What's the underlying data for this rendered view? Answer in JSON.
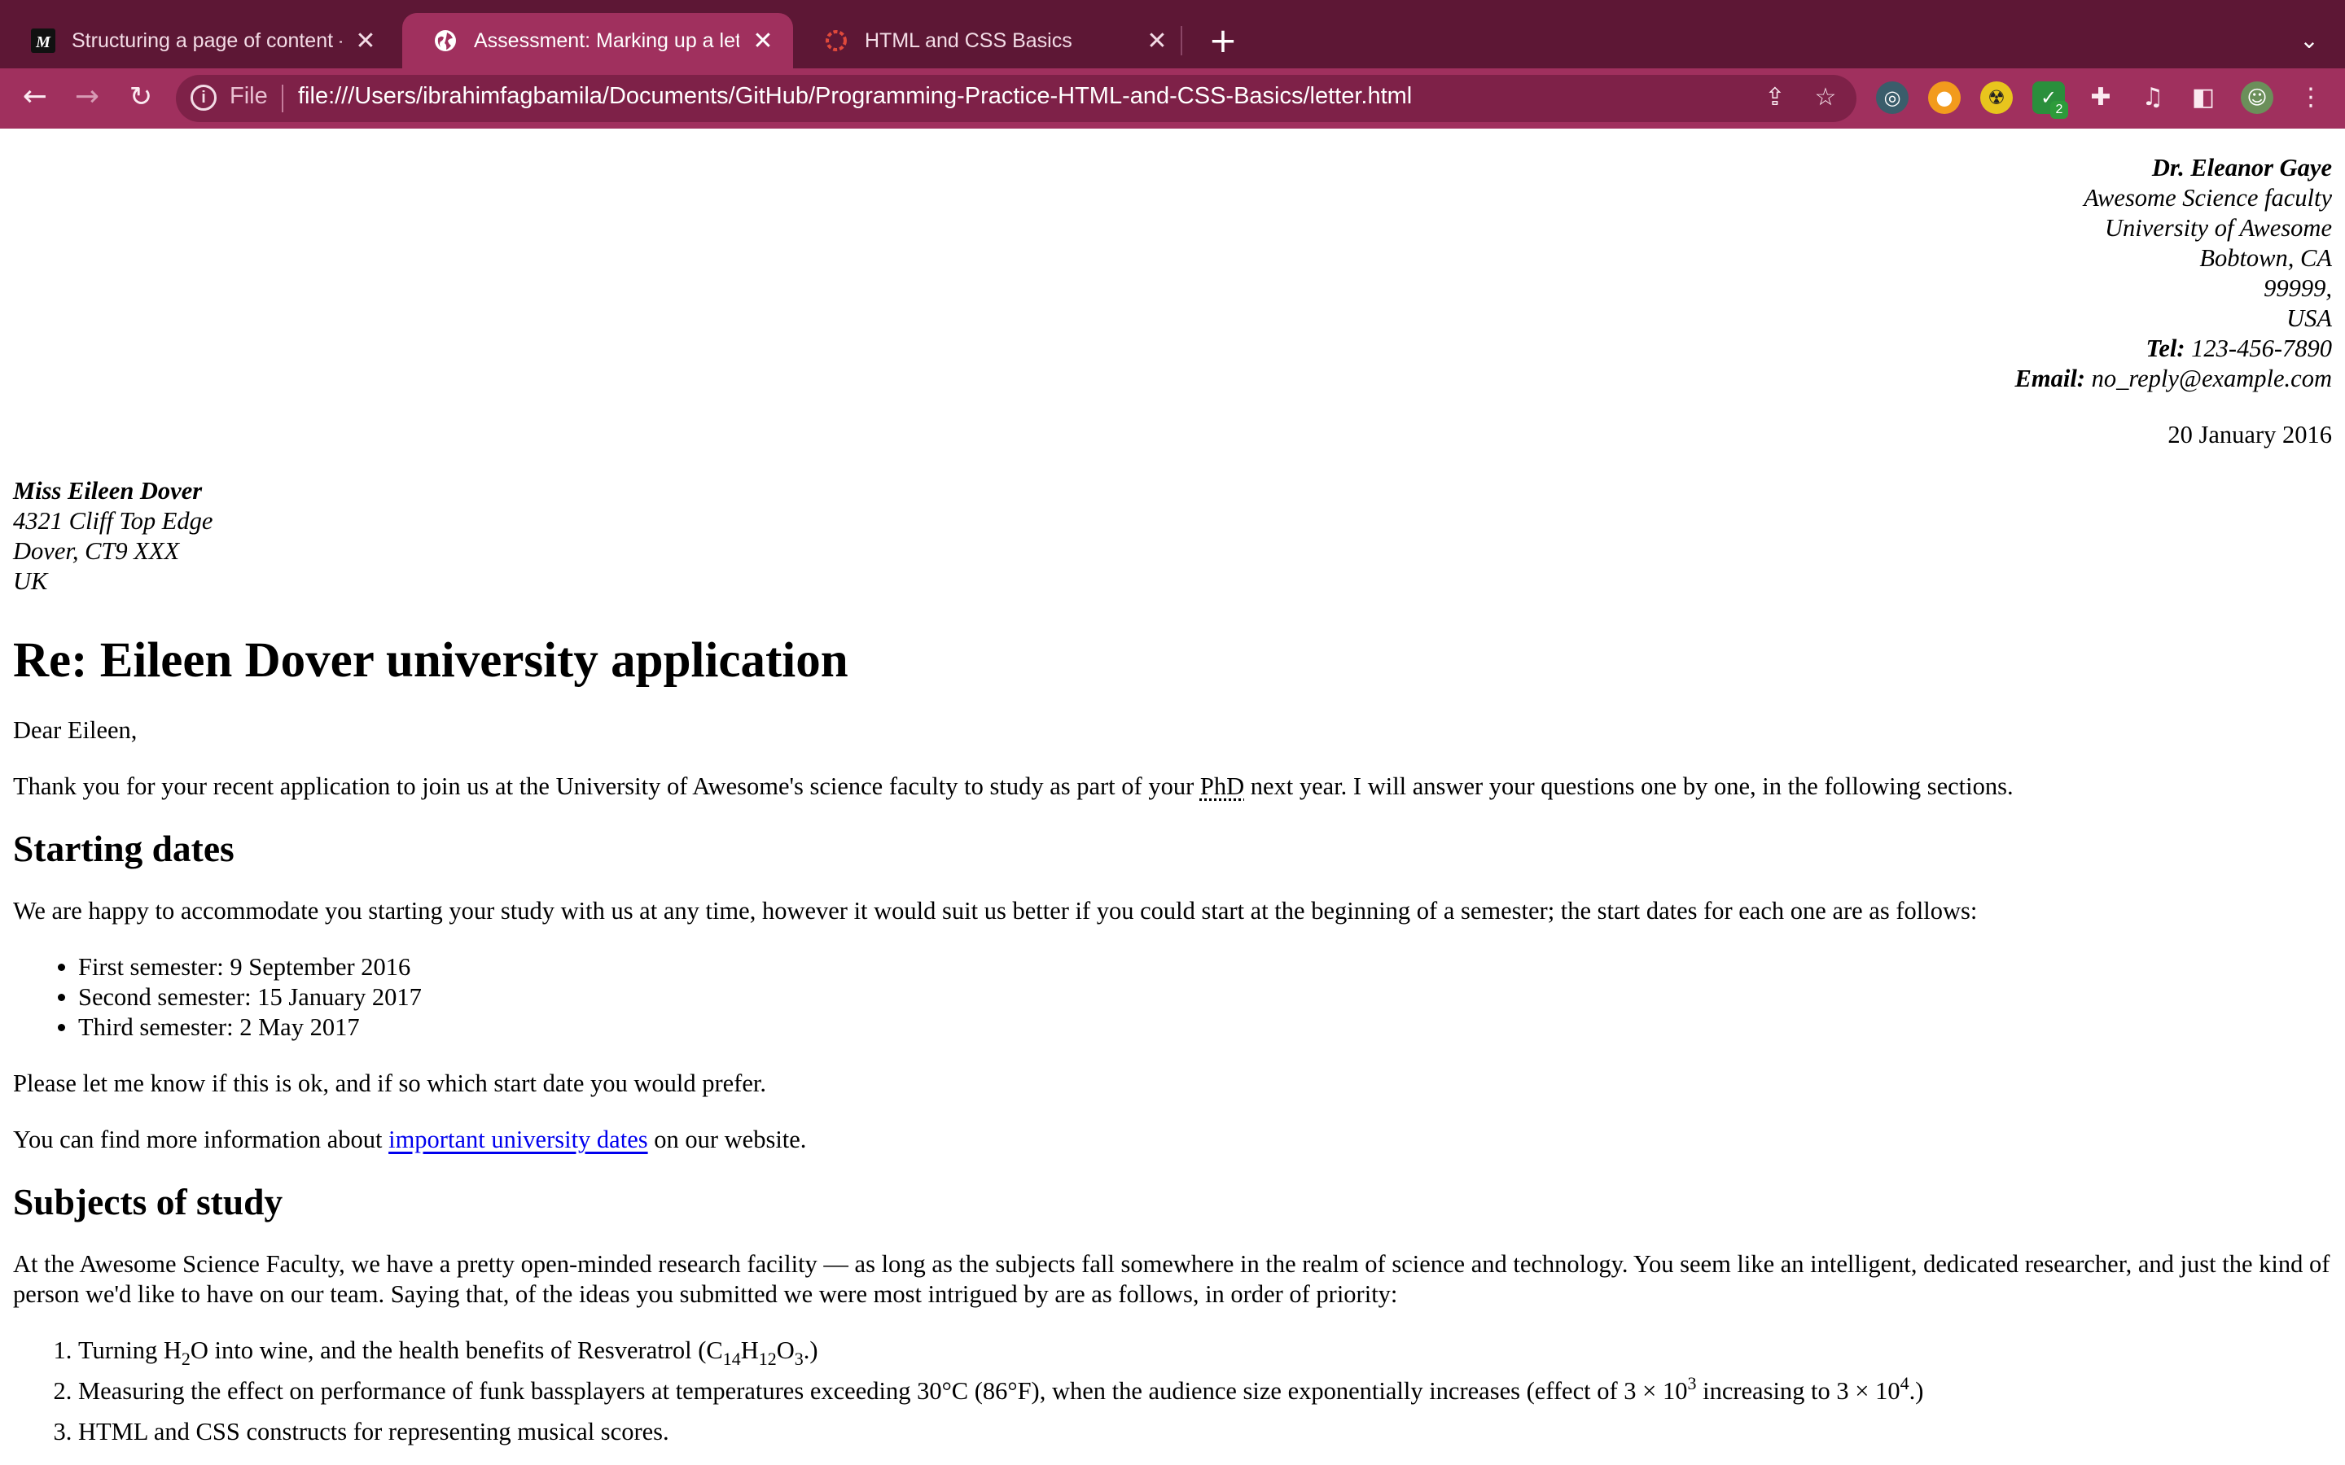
{
  "browser": {
    "tabs": [
      {
        "title": "Structuring a page of content -",
        "favicon": "mdn-logo-icon",
        "active": false
      },
      {
        "title": "Assessment: Marking up a letter",
        "favicon": "globe-icon",
        "active": true
      },
      {
        "title": "HTML and CSS Basics",
        "favicon": "loading-spinner-icon",
        "active": false
      }
    ],
    "new_tab": "+",
    "address": {
      "scheme_label": "File",
      "url": "file:///Users/ibrahimfagbamila/Documents/GitHub/Programming-Practice-HTML-and-CSS-Basics/letter.html"
    },
    "extension_badge": "2",
    "colors": {
      "tabbar": "#5d1735",
      "toolbar": "#a0305e",
      "omnibox": "#7e2148"
    }
  },
  "letter": {
    "sender": {
      "name": "Dr. Eleanor Gaye",
      "lines": [
        "Awesome Science faculty",
        "University of Awesome",
        "Bobtown, CA",
        "99999,",
        "USA"
      ],
      "tel_label": "Tel:",
      "tel": "123-456-7890",
      "email_label": "Email:",
      "email": "no_reply@example.com"
    },
    "date": "20 January 2016",
    "recipient": {
      "name": "Miss Eileen Dover",
      "lines": [
        "4321 Cliff Top Edge",
        "Dover, CT9 XXX",
        "UK"
      ]
    },
    "heading": "Re: Eileen Dover university application",
    "greeting": "Dear Eileen,",
    "intro_before": "Thank you for your recent application to join us at the University of Awesome's science faculty to study as part of your ",
    "intro_abbr": "PhD",
    "intro_after": " next year. I will answer your questions one by one, in the following sections.",
    "section1": {
      "title": "Starting dates",
      "para": "We are happy to accommodate you starting your study with us at any time, however it would suit us better if you could start at the beginning of a semester; the start dates for each one are as follows:",
      "dates": [
        "First semester: 9 September 2016",
        "Second semester: 15 January 2017",
        "Third semester: 2 May 2017"
      ],
      "followup": "Please let me know if this is ok, and if so which start date you would prefer.",
      "more_before": "You can find more information about ",
      "more_link": "important university dates",
      "more_after": " on our website."
    },
    "section2": {
      "title": "Subjects of study",
      "para": "At the Awesome Science Faculty, we have a pretty open-minded research facility — as long as the subjects fall somewhere in the realm of science and technology. You seem like an intelligent, dedicated researcher, and just the kind of person we'd like to have on our team. Saying that, of the ideas you submitted we were most intrigued by are as follows, in order of priority:",
      "item1": {
        "a": "Turning H",
        "b": "2",
        "c": "O into wine, and the health benefits of Resveratrol (C",
        "d": "14",
        "e": "H",
        "f": "12",
        "g": "O",
        "h": "3",
        "i": ".)"
      },
      "item2": {
        "a": "Measuring the effect on performance of funk bassplayers at temperatures exceeding 30°C (86°F), when the audience size exponentially increases (effect of 3 × 10",
        "b": "3",
        "c": " increasing to 3 × 10",
        "d": "4",
        "e": ".)"
      },
      "item3": "HTML and CSS constructs for representing musical scores."
    }
  }
}
